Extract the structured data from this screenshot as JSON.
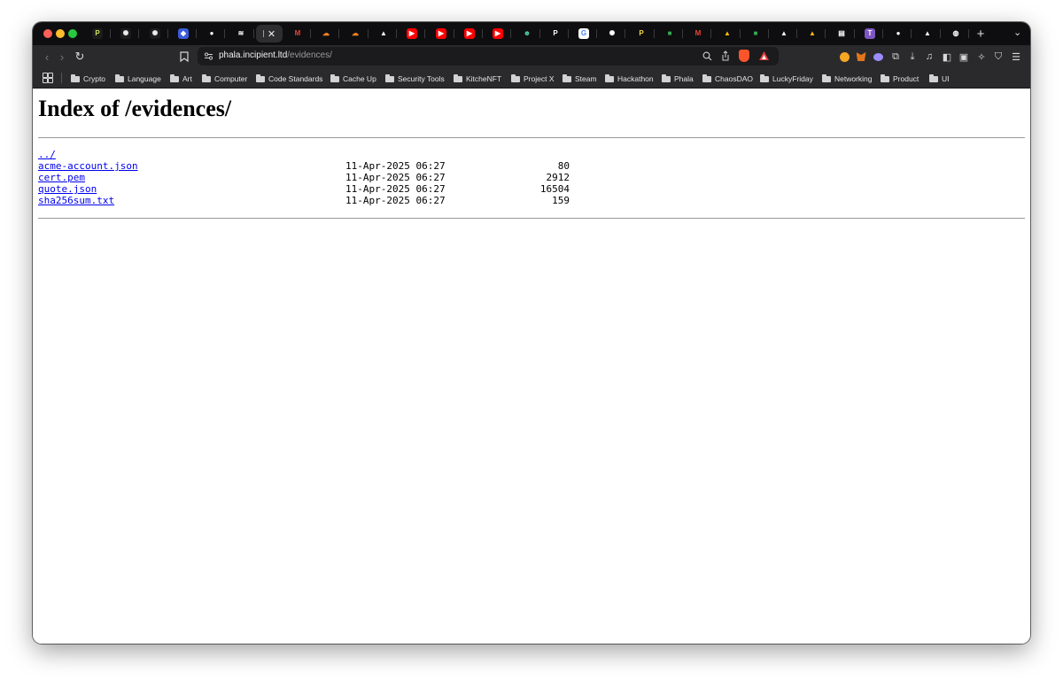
{
  "browser": {
    "tabs": [
      {
        "icon": "proton-icon",
        "glyph": "P",
        "color": "#1c1c1c",
        "fg": "#d4e157"
      },
      {
        "icon": "openai-icon",
        "glyph": "✺",
        "color": "#1c1c1c",
        "fg": "#eeeeee"
      },
      {
        "icon": "openai-icon",
        "glyph": "✺",
        "color": "#1c1c1c",
        "fg": "#eeeeee"
      },
      {
        "icon": "chain-icon",
        "glyph": "◆",
        "color": "#3b5bdb",
        "fg": "#ffffff"
      },
      {
        "icon": "github-icon",
        "glyph": "●",
        "color": "#0e0e10",
        "fg": "#ffffff"
      },
      {
        "icon": "layers-icon",
        "glyph": "≋",
        "color": "#0e0e10",
        "fg": "#ffffff"
      },
      {
        "icon": "active-tab",
        "glyph": "",
        "color": "#2e2e31",
        "fg": "#ffffff",
        "active": true
      },
      {
        "icon": "gmail-icon",
        "glyph": "M",
        "color": "#0e0e10",
        "fg": "#ea4335"
      },
      {
        "icon": "cloudflare-icon",
        "glyph": "☁",
        "color": "#0e0e10",
        "fg": "#f48120"
      },
      {
        "icon": "cloudflare-icon",
        "glyph": "☁",
        "color": "#0e0e10",
        "fg": "#f48120"
      },
      {
        "icon": "vercel-icon",
        "glyph": "▲",
        "color": "#0e0e10",
        "fg": "#ffffff"
      },
      {
        "icon": "youtube-icon",
        "glyph": "▶",
        "color": "#ff0000",
        "fg": "#ffffff"
      },
      {
        "icon": "youtube-icon",
        "glyph": "▶",
        "color": "#ff0000",
        "fg": "#ffffff"
      },
      {
        "icon": "youtube-icon",
        "glyph": "▶",
        "color": "#ff0000",
        "fg": "#ffffff"
      },
      {
        "icon": "youtube-icon",
        "glyph": "▶",
        "color": "#ff0000",
        "fg": "#ffffff"
      },
      {
        "icon": "bot-icon",
        "glyph": "☻",
        "color": "#0e0e10",
        "fg": "#4ecca3"
      },
      {
        "icon": "proton-icon",
        "glyph": "P",
        "color": "#0e0e10",
        "fg": "#ffffff"
      },
      {
        "icon": "google-icon",
        "glyph": "G",
        "color": "#ffffff",
        "fg": "#4285f4"
      },
      {
        "icon": "openai-icon",
        "glyph": "✺",
        "color": "#0e0e10",
        "fg": "#ffffff"
      },
      {
        "icon": "proton-icon",
        "glyph": "P",
        "color": "#0e0e10",
        "fg": "#f5d742"
      },
      {
        "icon": "meet-icon",
        "glyph": "■",
        "color": "#0e0e10",
        "fg": "#34a853"
      },
      {
        "icon": "gmail-icon",
        "glyph": "M",
        "color": "#0e0e10",
        "fg": "#ea4335"
      },
      {
        "icon": "drive-icon",
        "glyph": "▲",
        "color": "#0e0e10",
        "fg": "#fbbc04"
      },
      {
        "icon": "meet-icon",
        "glyph": "■",
        "color": "#0e0e10",
        "fg": "#34a853"
      },
      {
        "icon": "vercel-icon",
        "glyph": "▲",
        "color": "#0e0e10",
        "fg": "#ffffff"
      },
      {
        "icon": "drive-icon",
        "glyph": "▲",
        "color": "#0e0e10",
        "fg": "#fbbc04"
      },
      {
        "icon": "chart-icon",
        "glyph": "▤",
        "color": "#0e0e10",
        "fg": "#ffffff"
      },
      {
        "icon": "t-app-icon",
        "glyph": "T",
        "color": "#7e57c2",
        "fg": "#ffffff"
      },
      {
        "icon": "github-icon",
        "glyph": "●",
        "color": "#0e0e10",
        "fg": "#ffffff"
      },
      {
        "icon": "vercel-icon",
        "glyph": "▲",
        "color": "#0e0e10",
        "fg": "#ffffff"
      },
      {
        "icon": "globe-icon",
        "glyph": "◍",
        "color": "#0e0e10",
        "fg": "#ffffff"
      }
    ],
    "active_tab_close": "✕",
    "new_tab": "+",
    "tab_menu": "⌄"
  },
  "toolbar": {
    "back": "‹",
    "forward": "›",
    "reload": "↻",
    "bookmark": "⊓",
    "url_host": "phala.incipient.ltd",
    "url_path": "/evidences/"
  },
  "bookmarks": [
    "Crypto",
    "Language",
    "Art",
    "Computer",
    "Code Standards",
    "Cache Up",
    "Security Tools",
    "KitcheNFT",
    "Project X",
    "Steam",
    "Hackathon",
    "Phala",
    "ChaosDAO",
    "LuckyFriday",
    "Networking",
    "Product",
    "UI"
  ],
  "page": {
    "title": "Index of /evidences/",
    "parent_link": "../",
    "entries": [
      {
        "name": "acme-account.json",
        "date": "11-Apr-2025 06:27",
        "size": "80"
      },
      {
        "name": "cert.pem",
        "date": "11-Apr-2025 06:27",
        "size": "2912"
      },
      {
        "name": "quote.json",
        "date": "11-Apr-2025 06:27",
        "size": "16504"
      },
      {
        "name": "sha256sum.txt",
        "date": "11-Apr-2025 06:27",
        "size": "159"
      }
    ]
  }
}
